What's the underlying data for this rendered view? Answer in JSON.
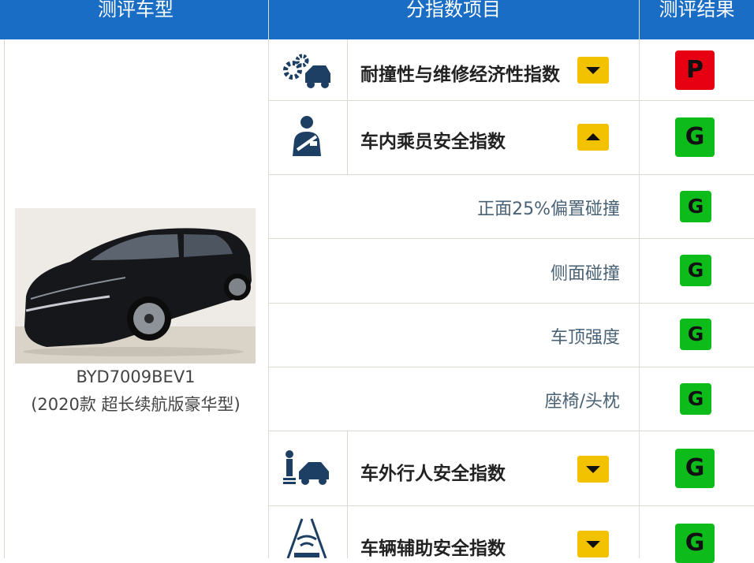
{
  "header": {
    "col_model": "测评车型",
    "col_items": "分指数项目",
    "col_result": "测评结果"
  },
  "vehicle": {
    "model_code": "BYD7009BEV1",
    "model_desc": "(2020款 超长续航版豪华型)"
  },
  "rows": {
    "repair": {
      "label": "耐撞性与维修经济性指数",
      "toggle": "collapsed",
      "rating": "P",
      "rating_color": "#e60012",
      "icon": "car-repair-gears-icon"
    },
    "occupant": {
      "label": "车内乘员安全指数",
      "toggle": "expanded",
      "rating": "G",
      "rating_color": "#0dbb1b",
      "icon": "seated-occupant-seatbelt-icon"
    },
    "sub_frontal": {
      "label": "正面25%偏置碰撞",
      "rating": "G"
    },
    "sub_side": {
      "label": "侧面碰撞",
      "rating": "G"
    },
    "sub_roof": {
      "label": "车顶强度",
      "rating": "G"
    },
    "sub_seat": {
      "label": "座椅/头枕",
      "rating": "G"
    },
    "pedestrian": {
      "label": "车外行人安全指数",
      "toggle": "collapsed",
      "rating": "G",
      "rating_color": "#0dbb1b",
      "icon": "pedestrian-car-icon"
    },
    "assist": {
      "label": "车辆辅助安全指数",
      "toggle": "collapsed",
      "rating": "G",
      "rating_color": "#0dbb1b",
      "icon": "driver-assist-radar-icon"
    }
  },
  "colors": {
    "header_bg": "#1a6dc4",
    "good": "#0dbb1b",
    "poor": "#e60012",
    "toggle": "#f2c200"
  }
}
